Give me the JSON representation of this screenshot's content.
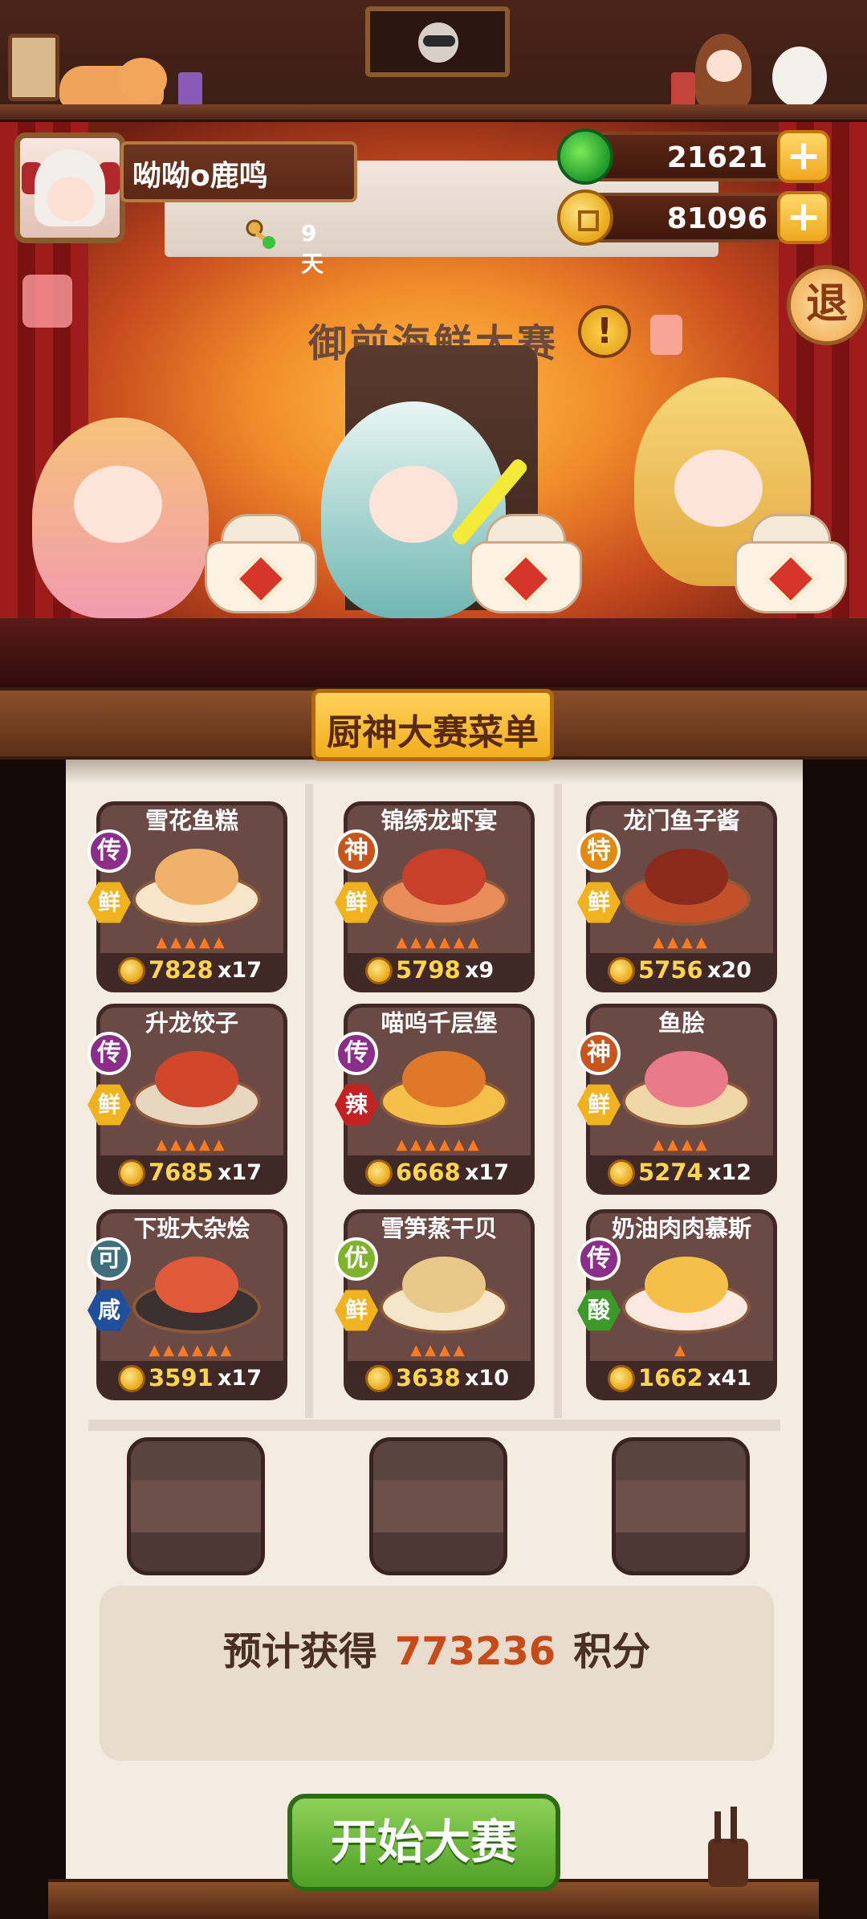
{
  "player": {
    "name": "呦呦o鹿鸣",
    "days": "9天"
  },
  "currencies": {
    "jade": "21621",
    "coins": "81096",
    "plus_symbol": "+"
  },
  "stage": {
    "title": "御前海鲜大赛",
    "alert_symbol": "!",
    "exit_label": "退"
  },
  "menu": {
    "title": "厨神大赛菜单",
    "dishes": [
      {
        "name": "雪花鱼糕",
        "grade": "传",
        "flavor": "鲜",
        "price": "7828",
        "qty": "x17",
        "heat": 5
      },
      {
        "name": "锦绣龙虾宴",
        "grade": "神",
        "flavor": "鲜",
        "price": "5798",
        "qty": "x9",
        "heat": 6
      },
      {
        "name": "龙门鱼子酱",
        "grade": "特",
        "flavor": "鲜",
        "price": "5756",
        "qty": "x20",
        "heat": 4
      },
      {
        "name": "升龙饺子",
        "grade": "传",
        "flavor": "鲜",
        "price": "7685",
        "qty": "x17",
        "heat": 5
      },
      {
        "name": "喵呜千层堡",
        "grade": "传",
        "flavor": "辣",
        "price": "6668",
        "qty": "x17",
        "heat": 6
      },
      {
        "name": "鱼脍",
        "grade": "神",
        "flavor": "鲜",
        "price": "5274",
        "qty": "x12",
        "heat": 4
      },
      {
        "name": "下班大杂烩",
        "grade": "可",
        "flavor": "咸",
        "price": "3591",
        "qty": "x17",
        "heat": 6
      },
      {
        "name": "雪笋蒸干贝",
        "grade": "优",
        "flavor": "鲜",
        "price": "3638",
        "qty": "x10",
        "heat": 4
      },
      {
        "name": "奶油肉肉慕斯",
        "grade": "传",
        "flavor": "酸",
        "price": "1662",
        "qty": "x41",
        "heat": 1
      }
    ]
  },
  "points": {
    "prefix": "预计获得",
    "value": "773236",
    "suffix": "积分"
  },
  "start_button": "开始大赛",
  "colors": {
    "grade_传": "#8a2e8a",
    "grade_神": "#c8551b",
    "grade_特": "#e08a12",
    "grade_可": "#3f6f7a",
    "grade_优": "#7fb32a",
    "flavor_鲜": "#f0b21e",
    "flavor_辣": "#c42222",
    "flavor_咸": "#1f4e9c",
    "flavor_酸": "#3c9a2a"
  }
}
